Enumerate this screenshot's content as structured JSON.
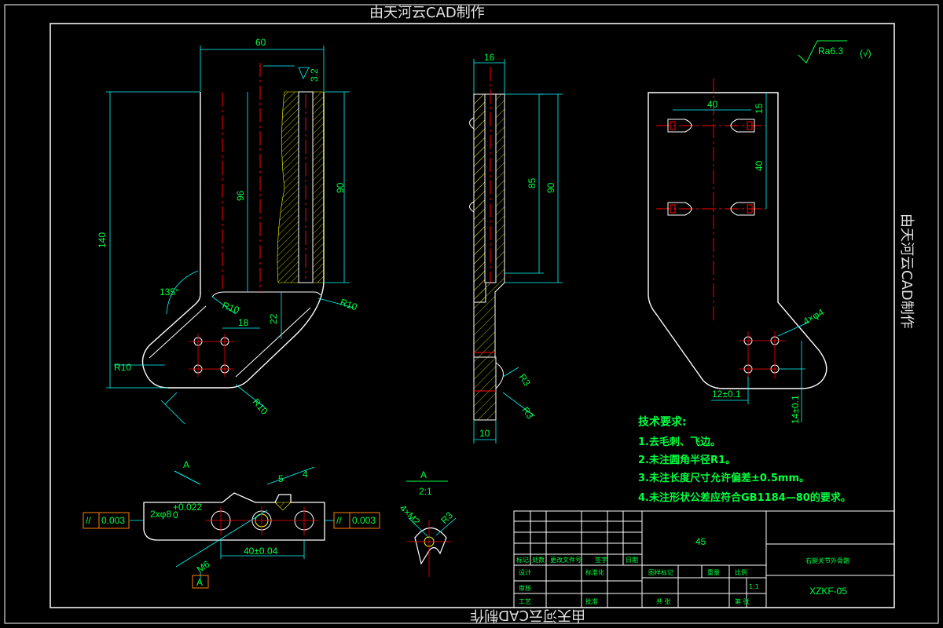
{
  "watermark": {
    "top": "由天河云CAD制作",
    "right": "由天河云CAD制作",
    "bottom": "由天河云CAD制作"
  },
  "roughness": {
    "value": "Ra6.3",
    "suffix": "(√)"
  },
  "view_front": {
    "dims": {
      "w60": "60",
      "h140": "140",
      "h96": "96",
      "h90": "90",
      "r32": "3.2",
      "angle": "135°",
      "r10a": "R10",
      "r10b": "R10",
      "r10c": "R10",
      "r10d": "R10",
      "d18": "18",
      "d22": "22"
    }
  },
  "view_side": {
    "dims": {
      "w16": "16",
      "h85": "85",
      "h90": "90",
      "w10": "10",
      "r3a": "R3",
      "r3b": "R3"
    }
  },
  "view_plan": {
    "dims": {
      "d40": "40",
      "d15": "15",
      "d40v": "40",
      "holes": "4×φ4",
      "d12": "12±0.1",
      "d14": "14±0.1"
    }
  },
  "section": {
    "arrow_label": "A",
    "dims": {
      "d5": "5",
      "d4": "4",
      "bore": "2xφ8",
      "tol_up": "+0.022",
      "tol_low": "0",
      "m6": "M6",
      "span": "40±0.04"
    },
    "tol_left": {
      "sym": "//",
      "val": "0.003"
    },
    "tol_right": {
      "sym": "//",
      "val": "0.003"
    },
    "datum": "A"
  },
  "detail": {
    "title": "A",
    "scale": "2:1",
    "thread": "4×M2",
    "radius": "R3"
  },
  "requirements": {
    "title": "技术要求:",
    "items": [
      "1.去毛刺、飞边。",
      "2.未注圆角半径R1。",
      "3.未注长度尺寸允许偏差±0.5mm。",
      "4.未注形状公差应符合GB1184—80的要求。"
    ]
  },
  "title_block": {
    "material": "45",
    "part_name": "右腿关节外骨骼",
    "drawing_no": "XZKF-05",
    "scale": "1:1",
    "labels": [
      "标记",
      "处数",
      "更改文件号",
      "签字",
      "日期",
      "设计",
      "标准化",
      "审核",
      "工艺",
      "批准",
      "图样标记",
      "重量",
      "比例",
      "共 张",
      "第 张"
    ]
  },
  "colors": {
    "line": "#ffffff",
    "dim": "#00ff40",
    "center": "#ff0000",
    "hatch": "#ffff00",
    "leader": "#00ffff",
    "tol": "#ff8000"
  }
}
